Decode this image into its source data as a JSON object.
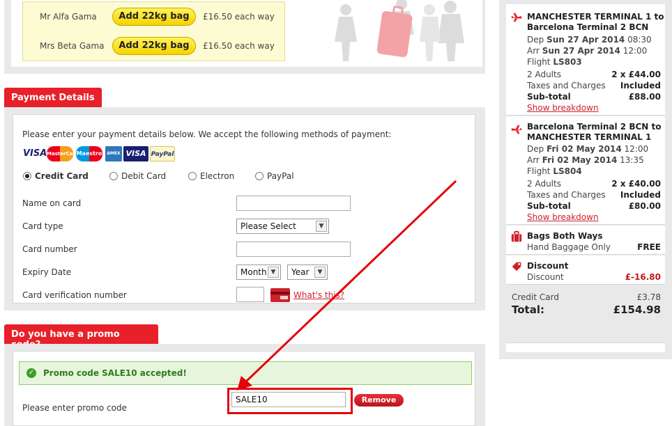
{
  "bags": {
    "rows": [
      {
        "name": "Mr Alfa Gama",
        "button": "Add 22kg bag",
        "price": "£16.50 each way"
      },
      {
        "name": "Mrs Beta Gama",
        "button": "Add 22kg bag",
        "price": "£16.50 each way"
      }
    ]
  },
  "payment": {
    "tab": "Payment Details",
    "intro": "Please enter your payment details below. We accept the following methods of payment:",
    "card_logos": [
      "VISA",
      "MasterCard",
      "Maestro",
      "AMEX",
      "VISA",
      "PayPal"
    ],
    "methods": [
      {
        "label": "Credit Card",
        "selected": true
      },
      {
        "label": "Debit Card",
        "selected": false
      },
      {
        "label": "Electron",
        "selected": false
      },
      {
        "label": "PayPal",
        "selected": false
      }
    ],
    "fields": {
      "name_label": "Name on card",
      "name_value": "",
      "type_label": "Card type",
      "type_value": "Please Select",
      "number_label": "Card number",
      "number_value": "",
      "expiry_label": "Expiry Date",
      "month_value": "Month",
      "year_value": "Year",
      "cvv_label": "Card verification number",
      "cvv_value": "",
      "whats_this": "What's this?"
    }
  },
  "promo": {
    "tab": "Do you have a promo code?",
    "success": "Promo code SALE10 accepted!",
    "label": "Please enter promo code",
    "value": "SALE10",
    "remove": "Remove"
  },
  "summary": {
    "outbound": {
      "route1": "MANCHESTER TERMINAL 1 to",
      "route2": "Barcelona Terminal 2 BCN",
      "dep_prefix": "Dep",
      "dep_date": "Sun 27 Apr 2014",
      "dep_time": "08:30",
      "arr_prefix": "Arr",
      "arr_date": "Sun 27 Apr 2014",
      "arr_time": "12:00",
      "flight_prefix": "Flight",
      "flight": "LS803",
      "pax": "2 Adults",
      "pax_price": "2 x £44.00",
      "taxes": "Taxes and Charges",
      "taxes_value": "Included",
      "subtotal": "Sub-total",
      "subtotal_value": "£88.00",
      "breakdown": "Show breakdown"
    },
    "inbound": {
      "route1": "Barcelona Terminal 2 BCN to",
      "route2": "MANCHESTER TERMINAL 1",
      "dep_prefix": "Dep",
      "dep_date": "Fri 02 May 2014",
      "dep_time": "12:00",
      "arr_prefix": "Arr",
      "arr_date": "Fri 02 May 2014",
      "arr_time": "13:35",
      "flight_prefix": "Flight",
      "flight": "LS804",
      "pax": "2 Adults",
      "pax_price": "2 x £40.00",
      "taxes": "Taxes and Charges",
      "taxes_value": "Included",
      "subtotal": "Sub-total",
      "subtotal_value": "£80.00",
      "breakdown": "Show breakdown"
    },
    "bags": {
      "title": "Bags Both Ways",
      "item": "Hand Baggage Only",
      "value": "FREE"
    },
    "discount": {
      "title": "Discount",
      "item": "Discount",
      "value": "£-16.80"
    },
    "credit_card": {
      "label": "Credit Card",
      "value": "£3.78"
    },
    "total": {
      "label": "Total:",
      "value": "£154.98"
    }
  },
  "colors": {
    "brand_red": "#e8202a",
    "highlight": "#e6000a",
    "button_yellow": "#fff45a",
    "success_green": "#2d7d1e"
  }
}
